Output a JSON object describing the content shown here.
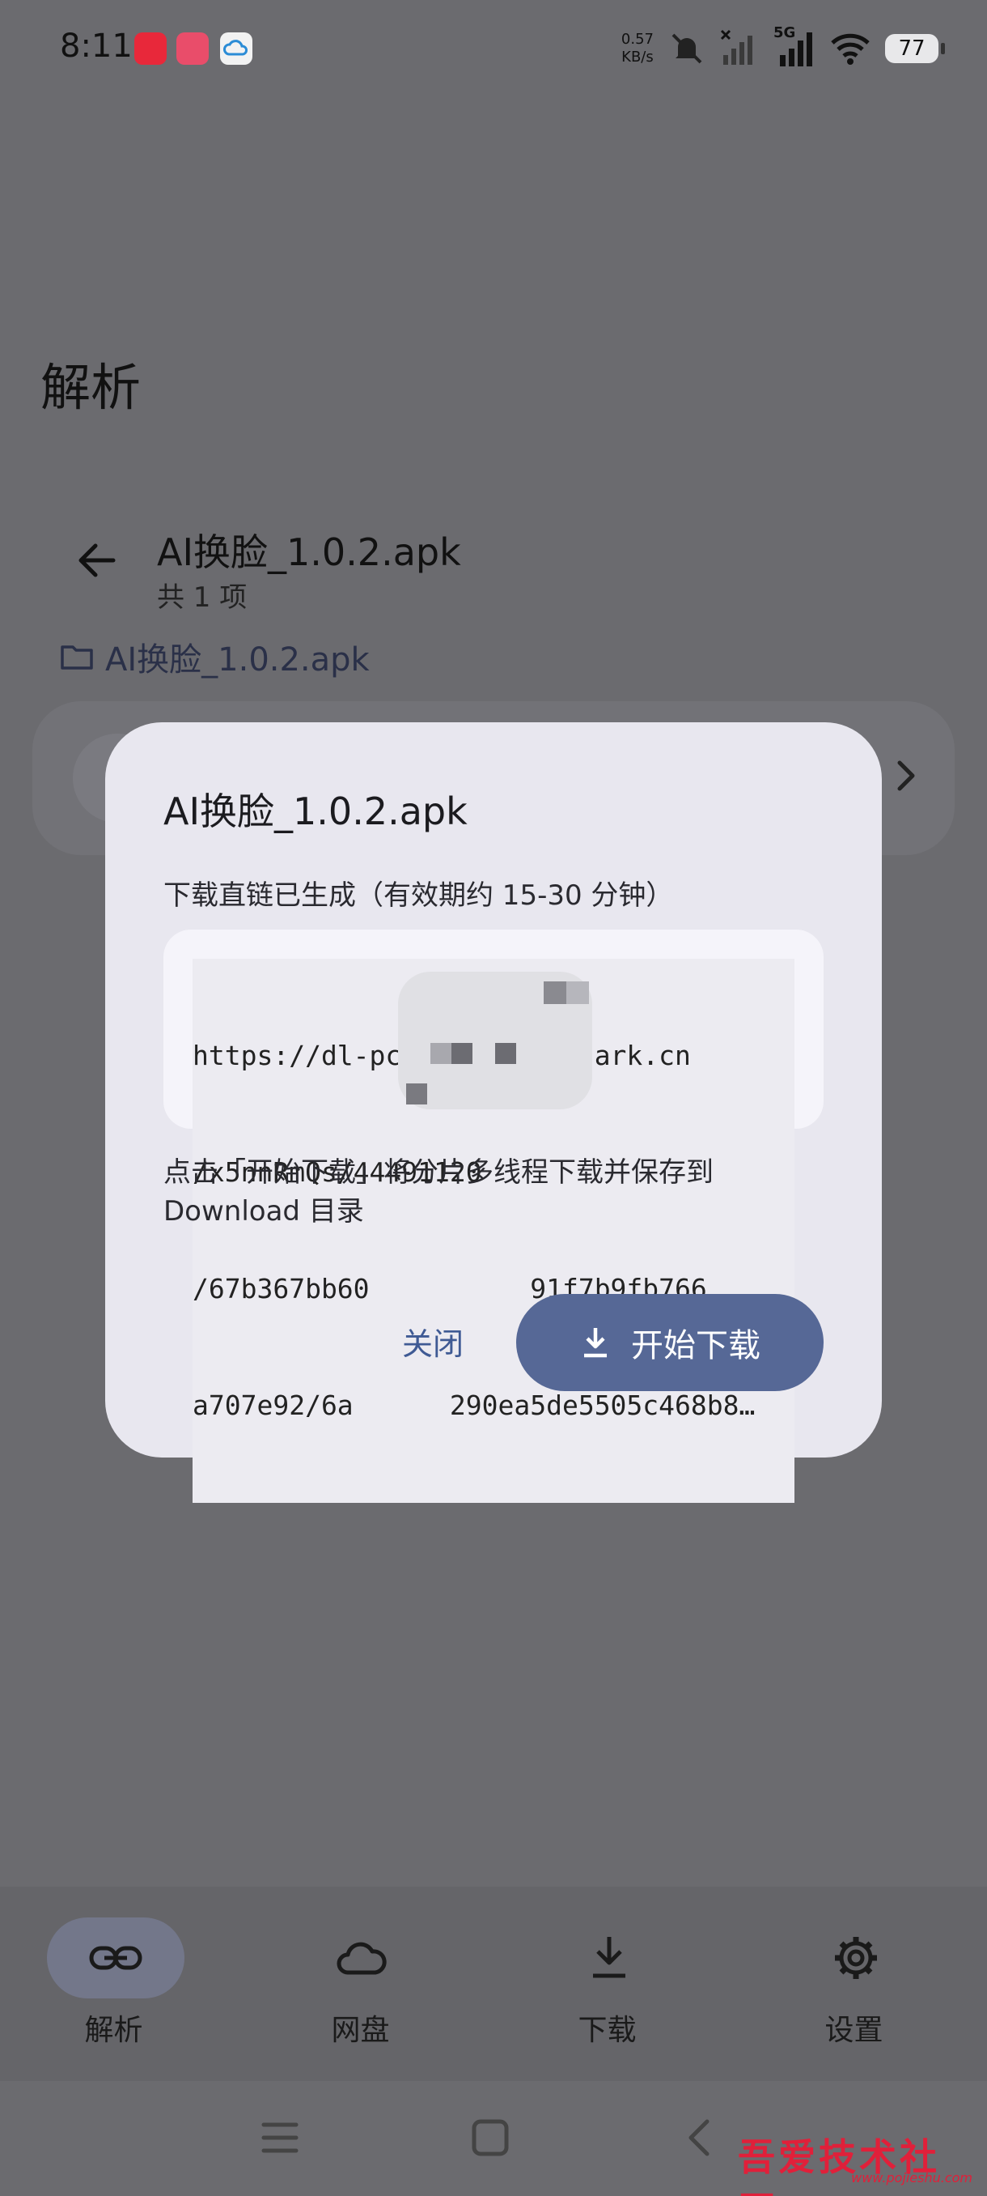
{
  "status_bar": {
    "time": "8:11",
    "net_speed_value": "0.57",
    "net_speed_unit": "KB/s",
    "network": "5G",
    "battery": "77"
  },
  "page": {
    "title": "解析",
    "file_name": "AI换脸_1.0.2.apk",
    "file_count": "共 1 项",
    "breadcrumb": "AI换脸_1.0.2.apk"
  },
  "dialog": {
    "title": "AI换脸_1.0.2.apk",
    "subtitle": "下载直链已生成（有效期约 15-30 分钟）",
    "link_lines": [
      "https://dl-pc-sz.drive.quark.cn",
      "/x5nnRmQs/44491120",
      "/67b367bb60          91f7b9fb766",
      "a707e92/6a      290ea5de5505c468b8…"
    ],
    "note": "点击「开始下载」将分片多线程下载并保存到 Download 目录",
    "close_label": "关闭",
    "download_label": "开始下载"
  },
  "bottom_nav": {
    "items": [
      {
        "label": "解析",
        "icon": "link-icon",
        "active": true
      },
      {
        "label": "网盘",
        "icon": "cloud-icon",
        "active": false
      },
      {
        "label": "下载",
        "icon": "download-icon",
        "active": false
      },
      {
        "label": "设置",
        "icon": "gear-icon",
        "active": false
      }
    ]
  },
  "watermark": {
    "title": "吾爱技术社区",
    "url": "www.pojieshu.com"
  },
  "colors": {
    "scrim": "#6b6b6f",
    "dialog_bg": "#e8e7ef",
    "primary": "#566896",
    "text_button": "#3f5a94"
  }
}
